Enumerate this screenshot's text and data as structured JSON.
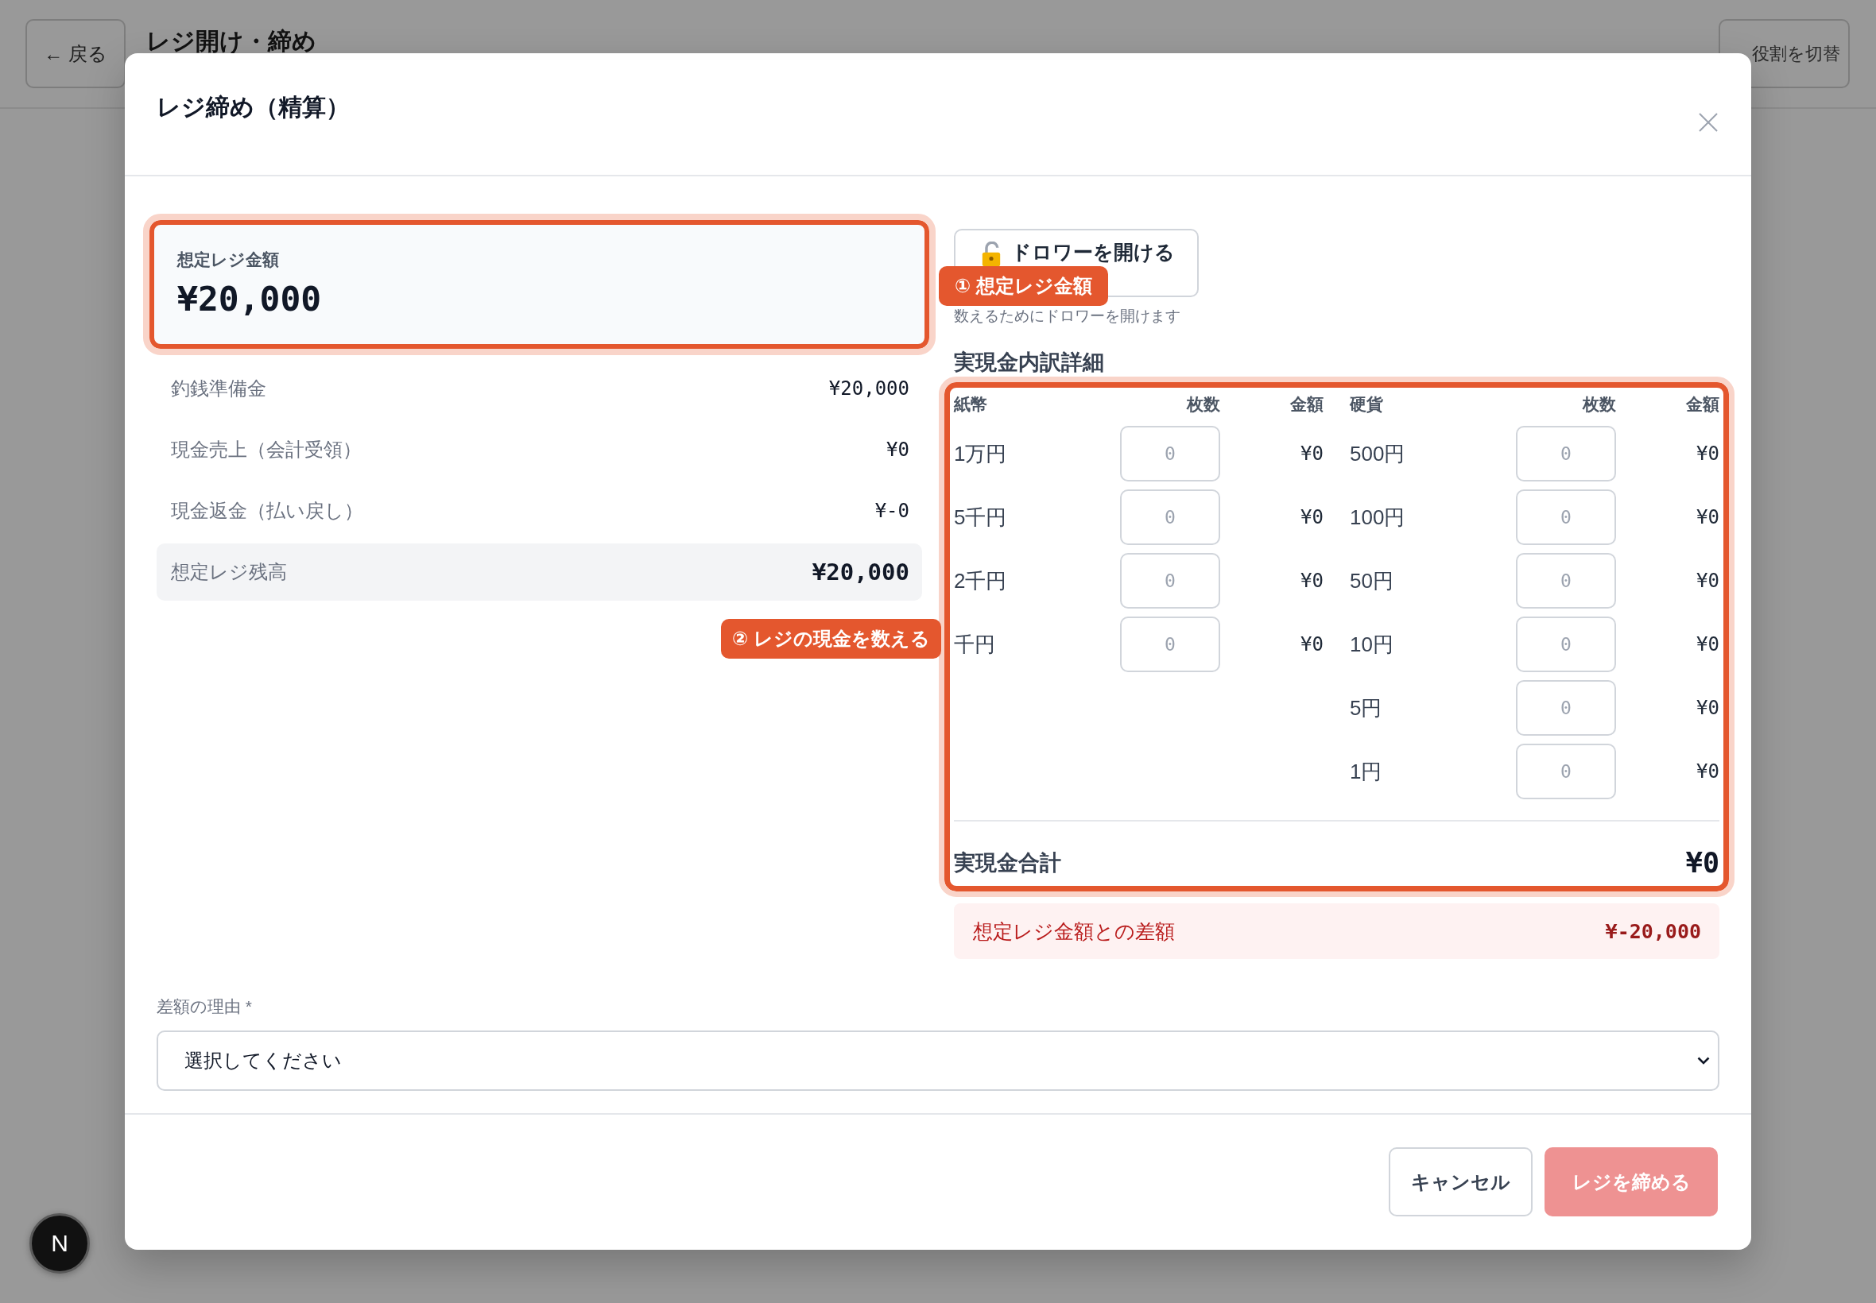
{
  "page": {
    "back_button": "← 戻る",
    "title": "レジ開け・締め",
    "role_button": "役割を切替"
  },
  "modal": {
    "title": "レジ締め（精算）"
  },
  "expected_card": {
    "label": "想定レジ金額",
    "amount": "¥20,000",
    "highlighted": true,
    "callout": "① 想定レジ金額"
  },
  "summary": [
    {
      "label": "釣銭準備金",
      "value": "¥20,000",
      "kind": "line"
    },
    {
      "label": "現金売上（会計受領）",
      "value": "¥0",
      "kind": "line"
    },
    {
      "label": "現金返金（払い戻し）",
      "value": "¥-0",
      "kind": "line"
    },
    {
      "label": "想定レジ残高",
      "value": "¥20,000",
      "kind": "total"
    }
  ],
  "drawer": {
    "button": "ドロワーを開ける",
    "hint": "数えるためにドロワーを開けます"
  },
  "breakdown": {
    "title": "実現金内訳詳細",
    "highlighted": true,
    "callout": "② レジの現金を数える",
    "groups": [
      {
        "heading": "紙幣",
        "count_heading": "枚数",
        "amount_heading": "金額",
        "rows": [
          {
            "label": "1万円",
            "placeholder": "0",
            "amount": "¥0"
          },
          {
            "label": "5千円",
            "placeholder": "0",
            "amount": "¥0"
          },
          {
            "label": "2千円",
            "placeholder": "0",
            "amount": "¥0"
          },
          {
            "label": "千円",
            "placeholder": "0",
            "amount": "¥0"
          }
        ]
      },
      {
        "heading": "硬貨",
        "count_heading": "枚数",
        "amount_heading": "金額",
        "rows": [
          {
            "label": "500円",
            "placeholder": "0",
            "amount": "¥0"
          },
          {
            "label": "100円",
            "placeholder": "0",
            "amount": "¥0"
          },
          {
            "label": "50円",
            "placeholder": "0",
            "amount": "¥0"
          },
          {
            "label": "10円",
            "placeholder": "0",
            "amount": "¥0"
          },
          {
            "label": "5円",
            "placeholder": "0",
            "amount": "¥0"
          },
          {
            "label": "1円",
            "placeholder": "0",
            "amount": "¥0"
          }
        ]
      }
    ],
    "total_label": "実現金合計",
    "total": "¥0"
  },
  "difference": {
    "label": "想定レジ金額との差額",
    "value": "¥-20,000",
    "kind": "shortage"
  },
  "reason": {
    "label": "差額の理由 *",
    "value": "選択してください"
  },
  "footer": {
    "cancel": "キャンセル",
    "submit": {
      "label": "レジを締める",
      "disabled": true
    }
  },
  "dev_indicator": {
    "label": "N"
  }
}
